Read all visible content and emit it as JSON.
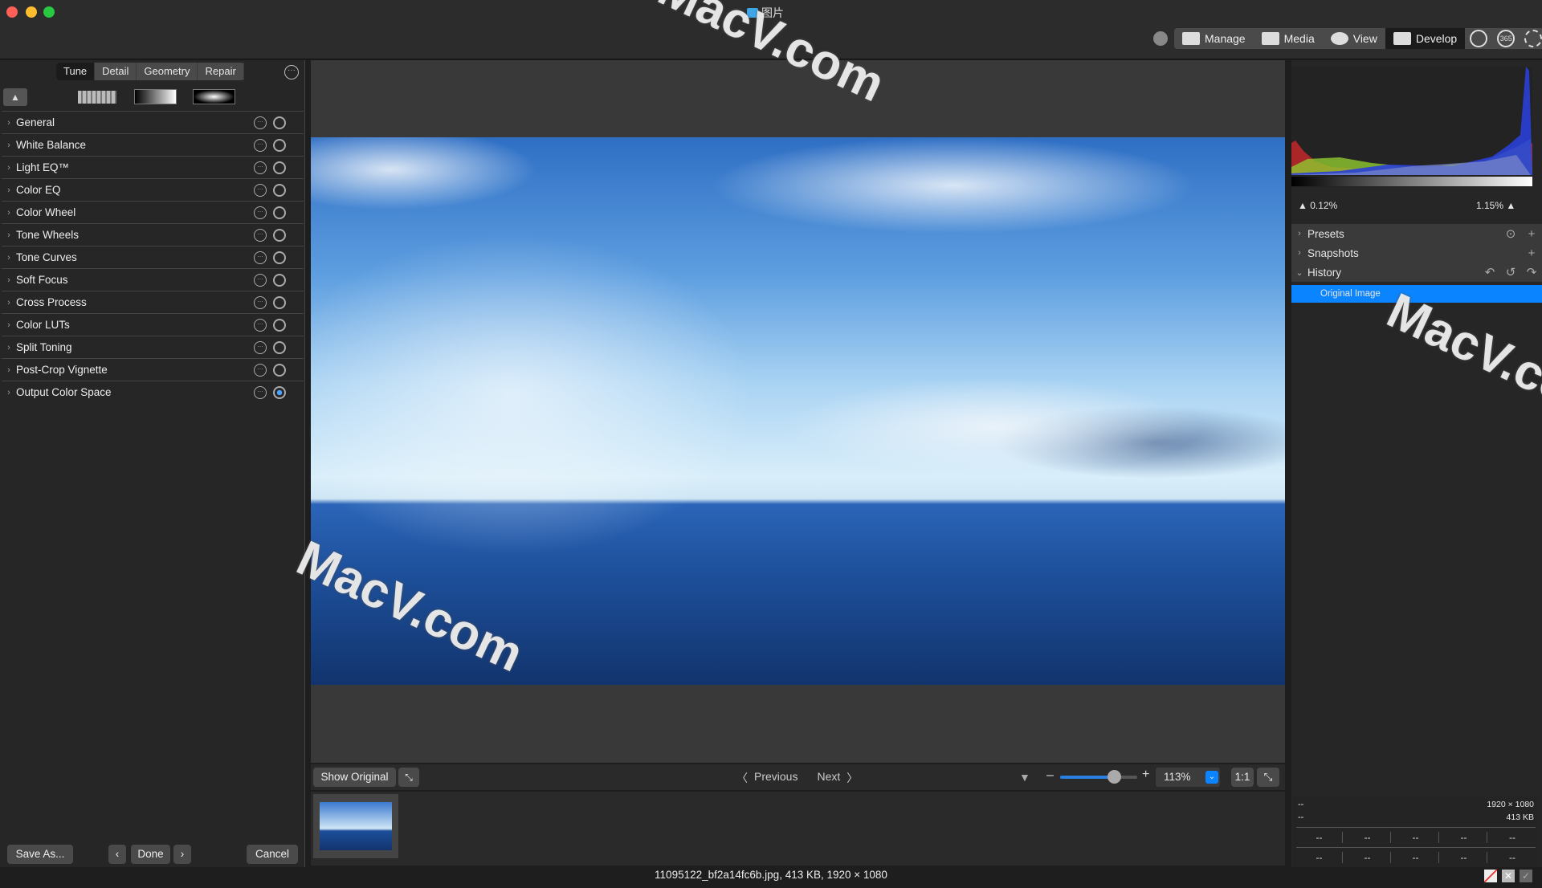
{
  "window": {
    "title": "图片"
  },
  "toolbar": {
    "items": [
      {
        "label": "Manage",
        "icon": "grid-icon"
      },
      {
        "label": "Media",
        "icon": "media-icon"
      },
      {
        "label": "View",
        "icon": "eye-icon"
      },
      {
        "label": "Develop",
        "icon": "develop-icon",
        "active": true
      }
    ],
    "extras": [
      "people-icon",
      "365-icon",
      "sync-icon"
    ],
    "badge_365": "365"
  },
  "left": {
    "tabs": [
      "Tune",
      "Detail",
      "Geometry",
      "Repair"
    ],
    "active_tab": "Tune",
    "panels": [
      "General",
      "White Balance",
      "Light EQ™",
      "Color EQ",
      "Color Wheel",
      "Tone Wheels",
      "Tone Curves",
      "Soft Focus",
      "Cross Process",
      "Color LUTs",
      "Split Toning",
      "Post-Crop Vignette",
      "Output Color Space"
    ],
    "enabled_panel": "Output Color Space",
    "buttons": {
      "save_as": "Save As...",
      "done": "Done",
      "cancel": "Cancel",
      "prev": "‹",
      "next": "›"
    }
  },
  "viewer": {
    "show_original": "Show Original",
    "previous": "Previous",
    "next": "Next",
    "zoom": "113%",
    "zoom_fraction": 0.7,
    "one_to_one": "1:1"
  },
  "status": {
    "file_info": "11095122_bf2a14fc6b.jpg, 413 KB, 1920 × 1080"
  },
  "right": {
    "clip_low": "0.12%",
    "clip_high": "1.15%",
    "sections": [
      {
        "label": "Presets",
        "expanded": false
      },
      {
        "label": "Snapshots",
        "expanded": false
      },
      {
        "label": "History",
        "expanded": true
      }
    ],
    "history": [
      "Original Image"
    ],
    "info": {
      "dims": "1920 × 1080",
      "size": "413 KB",
      "placeholder": "--"
    }
  },
  "watermark": "MacV.com",
  "colors": {
    "accent": "#0a84ff",
    "selection": "#0a84ff"
  }
}
